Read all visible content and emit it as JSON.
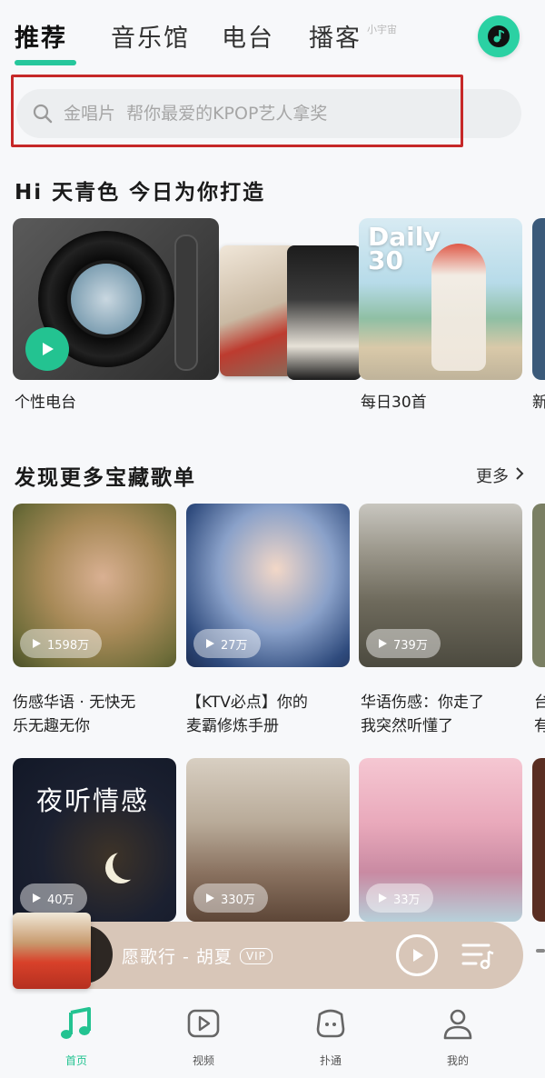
{
  "colors": {
    "accent": "#26c79c",
    "search_outline": "#c62828",
    "mini_player_bg": "#d7c4b6"
  },
  "top_tabs": {
    "items": [
      {
        "label": "推荐",
        "active": true
      },
      {
        "label": "音乐馆",
        "active": false
      },
      {
        "label": "电台",
        "active": false
      },
      {
        "label": "播客",
        "active": false
      }
    ],
    "podcast_sup": "小宇宙",
    "music_icon": "music-note-icon"
  },
  "search": {
    "placeholder": "金唱片  帮你最爱的KPOP艺人拿奖",
    "icon": "search-icon"
  },
  "greeting": {
    "title": "Hi 天青色  今日为你打造"
  },
  "daily_cards": [
    {
      "caption": "个性电台"
    },
    {
      "caption": "每日30首",
      "cover_text_line1": "Daily",
      "cover_text_line2": "30"
    },
    {
      "caption": "新"
    }
  ],
  "playlists": {
    "title": "发现更多宝藏歌单",
    "more_label": "更多",
    "row1": [
      {
        "plays": "1598万",
        "caption_line1": "伤感华语 · 无快无",
        "caption_line2": "乐无趣无你"
      },
      {
        "plays": "27万",
        "caption_line1": "【KTV必点】你的",
        "caption_line2": "麦霸修炼手册"
      },
      {
        "plays": "739万",
        "caption_line1": "华语伤感：你走了",
        "caption_line2": "我突然听懂了"
      },
      {
        "caption_line1": "台",
        "caption_line2": "有"
      }
    ],
    "row2": [
      {
        "overlay_title": "夜听情感",
        "plays": "40万"
      },
      {
        "plays": "330万"
      },
      {
        "plays": "33万"
      }
    ]
  },
  "mini_player": {
    "title": "愿歌行 - 胡夏",
    "vip": "VIP",
    "play_icon": "play-icon",
    "playlist_icon": "playlist-icon"
  },
  "bottom_nav": {
    "items": [
      {
        "label": "首页",
        "icon": "music-note-icon",
        "active": true
      },
      {
        "label": "视频",
        "icon": "video-play-icon",
        "active": false
      },
      {
        "label": "扑通",
        "icon": "chat-bubble-icon",
        "active": false
      },
      {
        "label": "我的",
        "icon": "user-icon",
        "active": false
      }
    ]
  }
}
